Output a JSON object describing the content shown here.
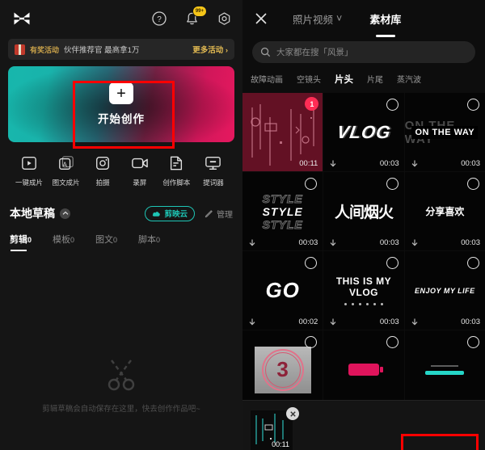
{
  "left": {
    "logo_name": "capcut-logo",
    "top_icons": [
      {
        "name": "help-icon",
        "label": "?"
      },
      {
        "name": "notification-bell-icon",
        "badge": "99+"
      },
      {
        "name": "settings-icon",
        "label": ""
      }
    ],
    "banner": {
      "tag": "有奖活动",
      "text": "伙伴推荐官 最高拿1万",
      "more": "更多活动 ›"
    },
    "create": {
      "label": "开始创作",
      "plus": "+"
    },
    "tools": [
      {
        "label": "一键成片",
        "icon": "play-frame-icon"
      },
      {
        "label": "图文成片",
        "icon": "text-image-icon"
      },
      {
        "label": "拍摄",
        "icon": "camera-icon"
      },
      {
        "label": "录屏",
        "icon": "video-record-icon"
      },
      {
        "label": "创作脚本",
        "icon": "script-document-icon"
      },
      {
        "label": "提词器",
        "icon": "teleprompter-icon"
      }
    ],
    "drafts": {
      "title": "本地草稿",
      "cloud_button": "剪映云",
      "manage": "管理",
      "tabs": [
        {
          "label": "剪辑",
          "count": "0",
          "active": true
        },
        {
          "label": "模板",
          "count": "0",
          "active": false
        },
        {
          "label": "图文",
          "count": "0",
          "active": false
        },
        {
          "label": "脚本",
          "count": "0",
          "active": false
        }
      ],
      "empty_text": "剪辑草稿会自动保存在这里，快去创作作品吧~"
    }
  },
  "right": {
    "close_label": "✕",
    "tabs": [
      {
        "label": "照片视频",
        "chevron": "˅",
        "active": false
      },
      {
        "label": "素材库",
        "chevron": "",
        "active": true
      }
    ],
    "search": {
      "placeholder": "大家都在搜「风景」",
      "icon": "search-icon"
    },
    "categories": [
      {
        "label": "故障动画",
        "active": false
      },
      {
        "label": "空镜头",
        "active": false
      },
      {
        "label": "片头",
        "active": true
      },
      {
        "label": "片尾",
        "active": false
      },
      {
        "label": "蒸汽波",
        "active": false
      }
    ],
    "items": [
      {
        "kind": "glitch",
        "text": "",
        "duration": "00:11",
        "selected": true,
        "badge": "1"
      },
      {
        "kind": "vlog",
        "text": "VLOG",
        "duration": "00:03",
        "selected": false
      },
      {
        "kind": "ontheway",
        "text": "ON THE WAY",
        "duration": "00:03",
        "selected": false
      },
      {
        "kind": "style",
        "text": "STYLE",
        "duration": "00:03",
        "selected": false
      },
      {
        "kind": "cn-big",
        "text": "人间烟火",
        "duration": "00:03",
        "selected": false
      },
      {
        "kind": "cn-share",
        "text": "分享喜欢",
        "duration": "00:03",
        "selected": false
      },
      {
        "kind": "go",
        "text": "GO",
        "duration": "00:02",
        "selected": false
      },
      {
        "kind": "thisis",
        "text": "THIS IS MY VLOG",
        "duration": "00:03",
        "selected": false
      },
      {
        "kind": "enjoy",
        "text": "ENJOY MY LIFE",
        "duration": "00:03",
        "selected": false
      },
      {
        "kind": "countdown",
        "text": "3",
        "duration": "",
        "selected": false
      },
      {
        "kind": "pinkbar",
        "text": "",
        "duration": "",
        "selected": false
      },
      {
        "kind": "tealbar",
        "text": "",
        "duration": "",
        "selected": false
      }
    ],
    "selection_bar": {
      "clip_duration": "00:11",
      "remove_label": "✕"
    }
  },
  "colors": {
    "accent_pink": "#ff2d55",
    "accent_teal": "#1ec6b6",
    "highlight_box": "#ff0000",
    "banner_gold": "#e0b852"
  }
}
